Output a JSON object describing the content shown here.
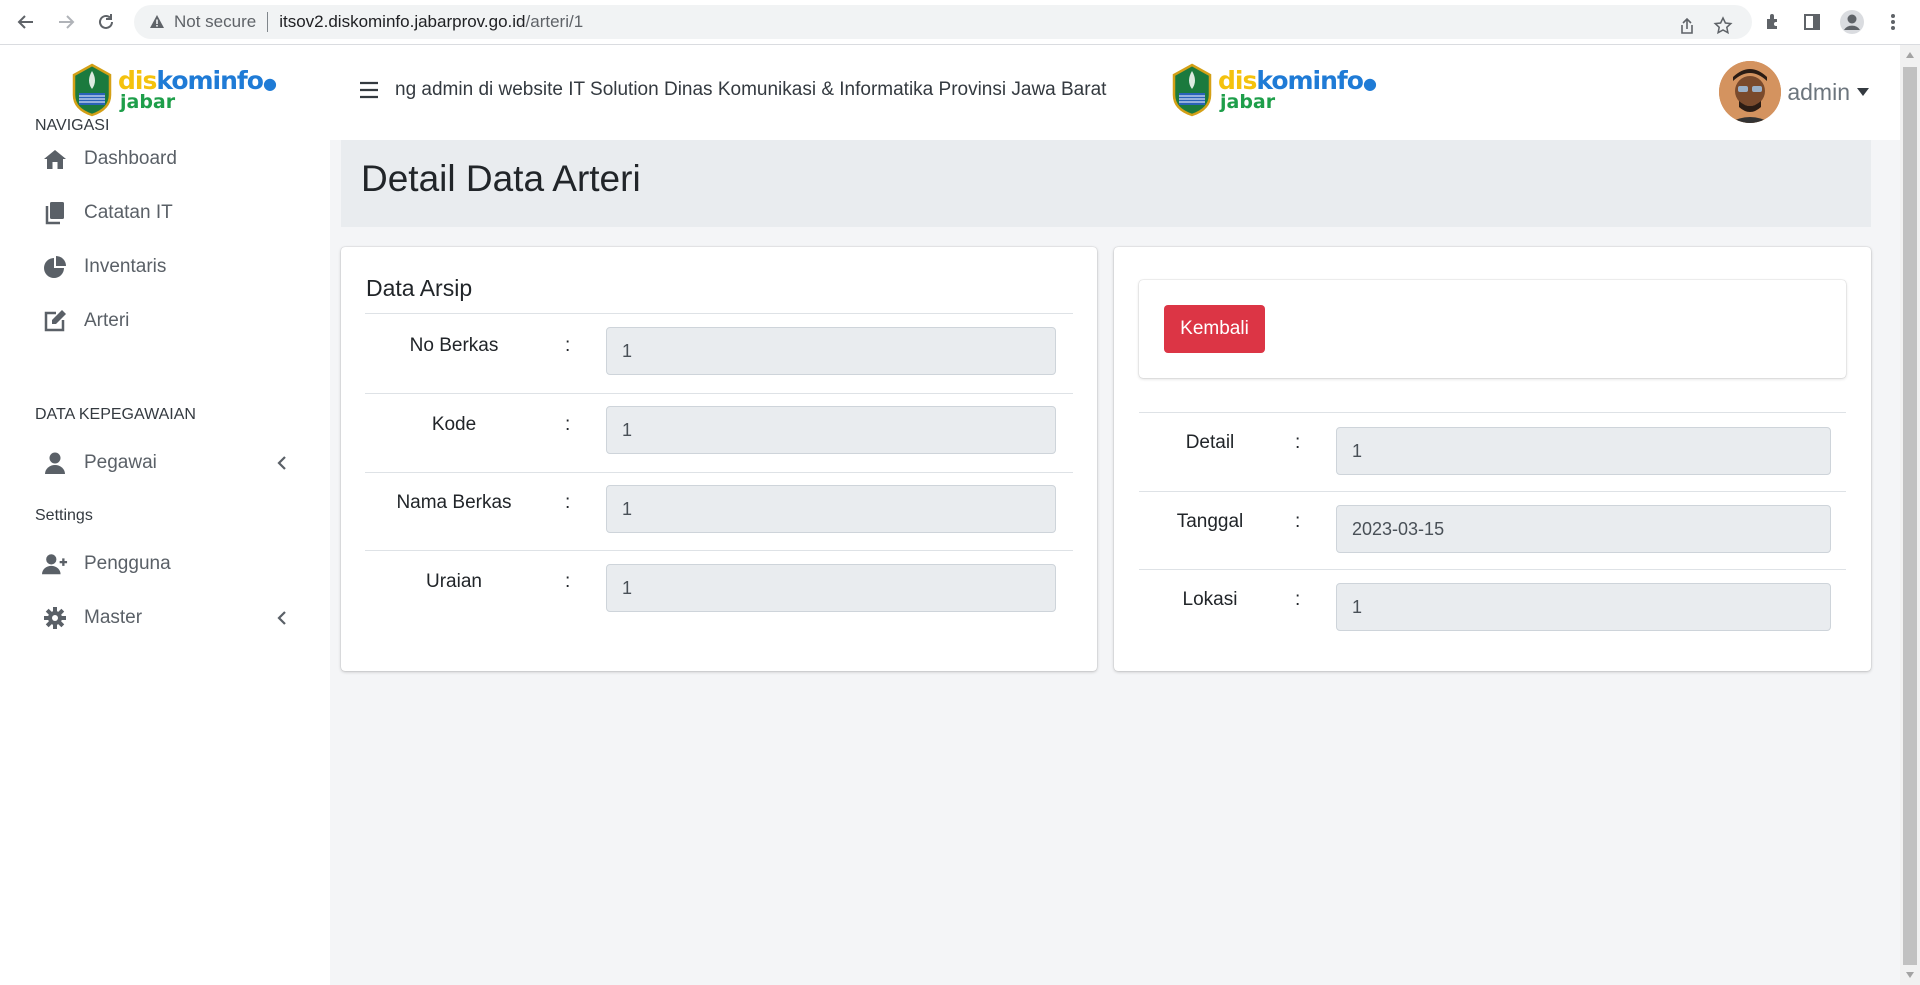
{
  "browser": {
    "security_label": "Not secure",
    "url_host": "itsov2.diskominfo.jabarprov.go.id",
    "url_path": "/arteri/1"
  },
  "logo": {
    "part_yellow": "dis",
    "part_blue": "kominfo",
    "sub": "jabar"
  },
  "sidebar": {
    "sections": [
      {
        "title": "NAVIGASI"
      },
      {
        "title": "DATA KEPEGAWAIAN"
      },
      {
        "title": "Settings"
      }
    ],
    "items": [
      {
        "label": "Dashboard",
        "icon": "home-icon"
      },
      {
        "label": "Catatan IT",
        "icon": "copy-icon"
      },
      {
        "label": "Inventaris",
        "icon": "pie-chart-icon"
      },
      {
        "label": "Arteri",
        "icon": "edit-icon"
      },
      {
        "label": "Pegawai",
        "icon": "user-icon",
        "has_submenu": true
      },
      {
        "label": "Pengguna",
        "icon": "user-plus-icon"
      },
      {
        "label": "Master",
        "icon": "gear-icon",
        "has_submenu": true
      }
    ]
  },
  "header": {
    "marquee": "ng admin di website IT Solution Dinas Komunikasi & Informatika Provinsi Jawa Barat",
    "user_name": "admin"
  },
  "page": {
    "title": "Detail Data Arteri"
  },
  "left_card": {
    "title": "Data Arsip",
    "rows": [
      {
        "label": "No Berkas",
        "value": "1"
      },
      {
        "label": "Kode",
        "value": "1"
      },
      {
        "label": "Nama Berkas",
        "value": "1"
      },
      {
        "label": "Uraian",
        "value": "1"
      }
    ]
  },
  "right_card": {
    "back_label": "Kembali",
    "rows": [
      {
        "label": "Detail",
        "value": "1"
      },
      {
        "label": "Tanggal",
        "value": "2023-03-15"
      },
      {
        "label": "Lokasi",
        "value": "1"
      }
    ]
  },
  "colon": ":",
  "colors": {
    "danger": "#dc3545",
    "field_bg": "#e9ecef",
    "content_bg": "#f4f5f7"
  }
}
